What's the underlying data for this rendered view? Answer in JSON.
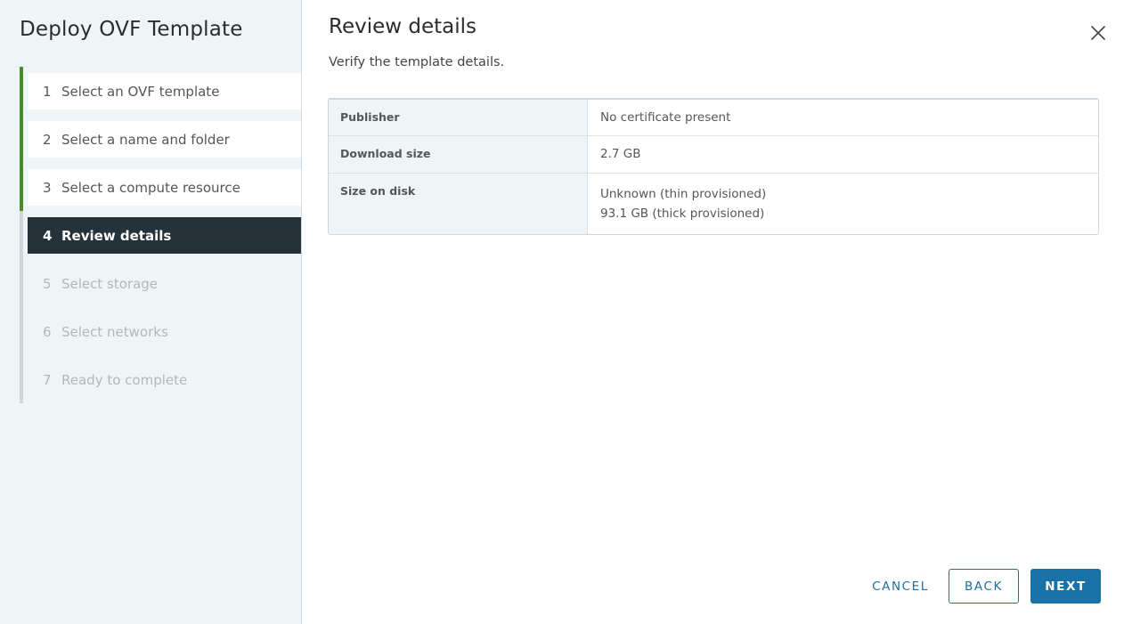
{
  "sidebar": {
    "title": "Deploy OVF Template",
    "steps": [
      {
        "number": "1",
        "label": "Select an OVF template",
        "state": "done"
      },
      {
        "number": "2",
        "label": "Select a name and folder",
        "state": "done"
      },
      {
        "number": "3",
        "label": "Select a compute resource",
        "state": "done"
      },
      {
        "number": "4",
        "label": "Review details",
        "state": "current"
      },
      {
        "number": "5",
        "label": "Select storage",
        "state": "future"
      },
      {
        "number": "6",
        "label": "Select networks",
        "state": "future"
      },
      {
        "number": "7",
        "label": "Ready to complete",
        "state": "future"
      }
    ]
  },
  "main": {
    "title": "Review details",
    "subtitle": "Verify the template details.",
    "details": [
      {
        "key": "Publisher",
        "value": "No certificate present",
        "value2": ""
      },
      {
        "key": "Download size",
        "value": "2.7 GB",
        "value2": ""
      },
      {
        "key": "Size on disk",
        "value": "Unknown (thin provisioned)",
        "value2": "93.1 GB (thick provisioned)"
      }
    ]
  },
  "footer": {
    "cancel_label": "CANCEL",
    "back_label": "BACK",
    "next_label": "NEXT"
  },
  "icons": {
    "close": "close-icon"
  },
  "colors": {
    "accent": "#1a73a8",
    "step_done_rail": "#4b8a2b",
    "current_step_bg": "#25323a",
    "sidebar_bg": "#eff4f7"
  }
}
